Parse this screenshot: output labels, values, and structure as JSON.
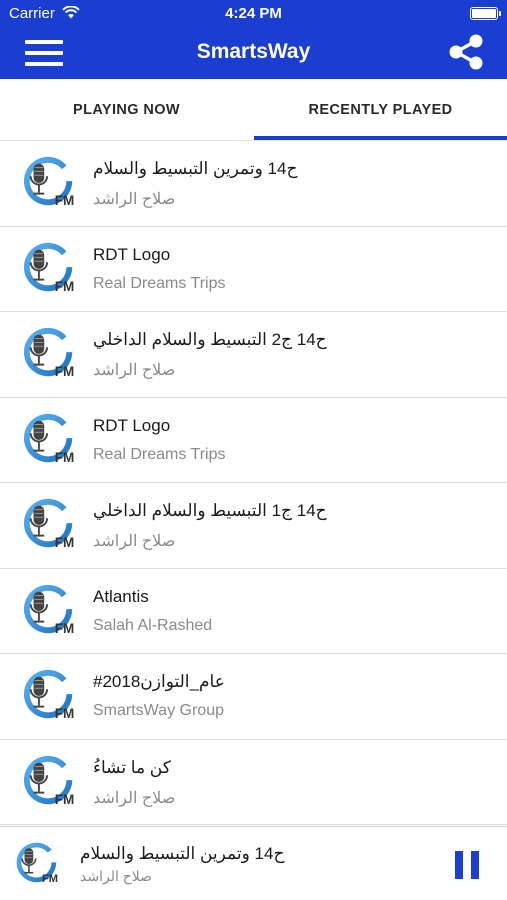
{
  "status_bar": {
    "carrier": "Carrier",
    "time": "4:24 PM"
  },
  "header": {
    "title": "SmartsWay",
    "menu_icon": "hamburger-menu-icon",
    "share_icon": "share-icon"
  },
  "tabs": [
    {
      "label": "PLAYING NOW",
      "selected": false
    },
    {
      "label": "RECENTLY PLAYED",
      "selected": true
    }
  ],
  "colors": {
    "accent": "#1a3fd0",
    "divider": "#dcdcdc",
    "subtitle": "#8a8a8a"
  },
  "recently_played": [
    {
      "title": "ح14 وتمرين التبسيط والسلام",
      "subtitle": "صلاح الراشد"
    },
    {
      "title": "RDT Logo",
      "subtitle": "Real Dreams Trips"
    },
    {
      "title": "ح14 ج2 التبسيط والسلام الداخلي",
      "subtitle": "صلاح الراشد"
    },
    {
      "title": "RDT Logo",
      "subtitle": "Real Dreams Trips"
    },
    {
      "title": "ح14 ج1 التبسيط والسلام الداخلي",
      "subtitle": "صلاح الراشد"
    },
    {
      "title": "Atlantis",
      "subtitle": "Salah Al-Rashed"
    },
    {
      "title": "#عام_التوازن2018",
      "subtitle": "SmartsWay Group"
    },
    {
      "title": "كن ما تشاءُ",
      "subtitle": "صلاح الراشد"
    }
  ],
  "artwork": {
    "icon": "fm-microphone-icon",
    "label": "FM"
  },
  "now_playing": {
    "title": "ح14 وتمرين التبسيط والسلام",
    "subtitle": "صلاح الراشد",
    "control_icon": "pause-icon"
  }
}
